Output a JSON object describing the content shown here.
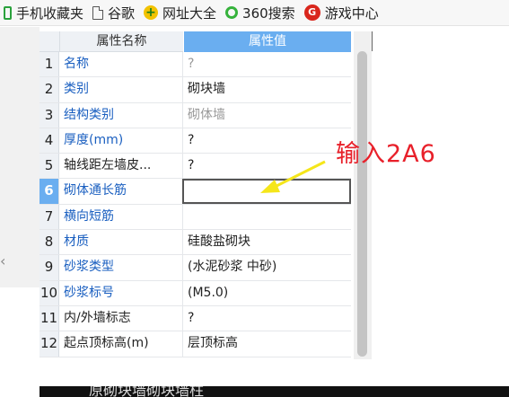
{
  "bookmarks": [
    {
      "label": "手机收藏夹",
      "icon": "phone-icon"
    },
    {
      "label": "谷歌",
      "icon": "page-icon"
    },
    {
      "label": "网址大全",
      "icon": "nav-plus-icon"
    },
    {
      "label": "360搜索",
      "icon": "search-360-icon"
    },
    {
      "label": "游戏中心",
      "icon": "game-icon"
    }
  ],
  "grid": {
    "col_name": "属性名称",
    "col_value": "属性值",
    "rows": [
      {
        "num": "1",
        "name": "名称",
        "value": "?"
      },
      {
        "num": "2",
        "name": "类别",
        "value": "砌块墙"
      },
      {
        "num": "3",
        "name": "结构类别",
        "value": "砌体墙"
      },
      {
        "num": "4",
        "name": "厚度(mm)",
        "value": "?"
      },
      {
        "num": "5",
        "name": "轴线距左墙皮...",
        "value": "?"
      },
      {
        "num": "6",
        "name": "砌体通长筋",
        "value": ""
      },
      {
        "num": "7",
        "name": "横向短筋",
        "value": ""
      },
      {
        "num": "8",
        "name": "材质",
        "value": "硅酸盐砌块"
      },
      {
        "num": "9",
        "name": "砂浆类型",
        "value": "(水泥砂浆 中砂)"
      },
      {
        "num": "10",
        "name": "砂浆标号",
        "value": "(M5.0)"
      },
      {
        "num": "11",
        "name": "内/外墙标志",
        "value": "?"
      },
      {
        "num": "12",
        "name": "起点顶标高(m)",
        "value": "层顶标高"
      }
    ]
  },
  "annotation": {
    "text": "输入2A6",
    "color": "#e8202a",
    "arrow_color": "#f5e61a"
  },
  "accent_color": "#6aaef0",
  "bottom_band_text": "原砌块墙砌块墙柱"
}
